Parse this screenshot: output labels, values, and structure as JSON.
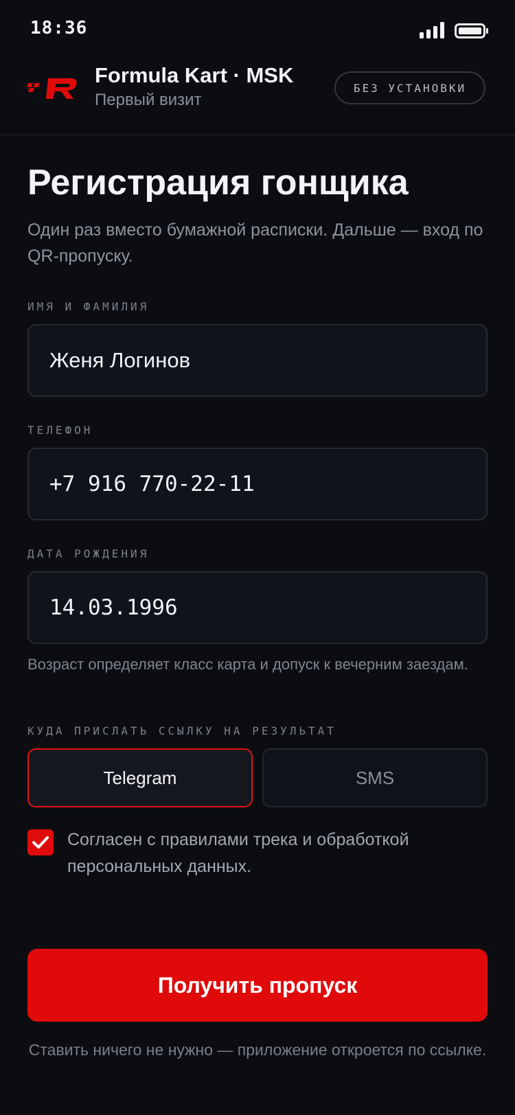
{
  "status_bar": {
    "time": "18:36",
    "signal_icon": "signal-bars-icon",
    "battery_icon": "battery-icon"
  },
  "header": {
    "logo_icon": "racing-r-logo",
    "brand": "Formula Kart · MSK",
    "subtitle": "Первый визит",
    "badge": "БЕЗ УСТАНОВКИ"
  },
  "main": {
    "title": "Регистрация гонщика",
    "intro": "Один раз вместо бумажной расписки. Дальше — вход по QR-пропуску."
  },
  "form": {
    "name": {
      "label": "ИМЯ И ФАМИЛИЯ",
      "value": "Женя Логинов"
    },
    "phone": {
      "label": "ТЕЛЕФОН",
      "value": "+7 916 770-22-11"
    },
    "birth": {
      "label": "ДАТА РОЖДЕНИЯ",
      "value": "14.03.1996",
      "hint": "Возраст определяет класс карта и допуск к вечерним заездам."
    },
    "delivery": {
      "label": "КУДА ПРИСЛАТЬ ССЫЛКУ НА РЕЗУЛЬТАТ",
      "options": [
        "Telegram",
        "SMS"
      ],
      "selected": "Telegram"
    },
    "consent": {
      "checked": true,
      "text": "Согласен с правилами трека и обработкой персональных данных."
    }
  },
  "cta": {
    "label": "Получить пропуск"
  },
  "footnote": "Ставить ничего не нужно — приложение откроется по ссылке.",
  "colors": {
    "background": "#0c0d11",
    "accent": "#e00a0a",
    "field": "#10131a",
    "muted": "#8e939d"
  }
}
